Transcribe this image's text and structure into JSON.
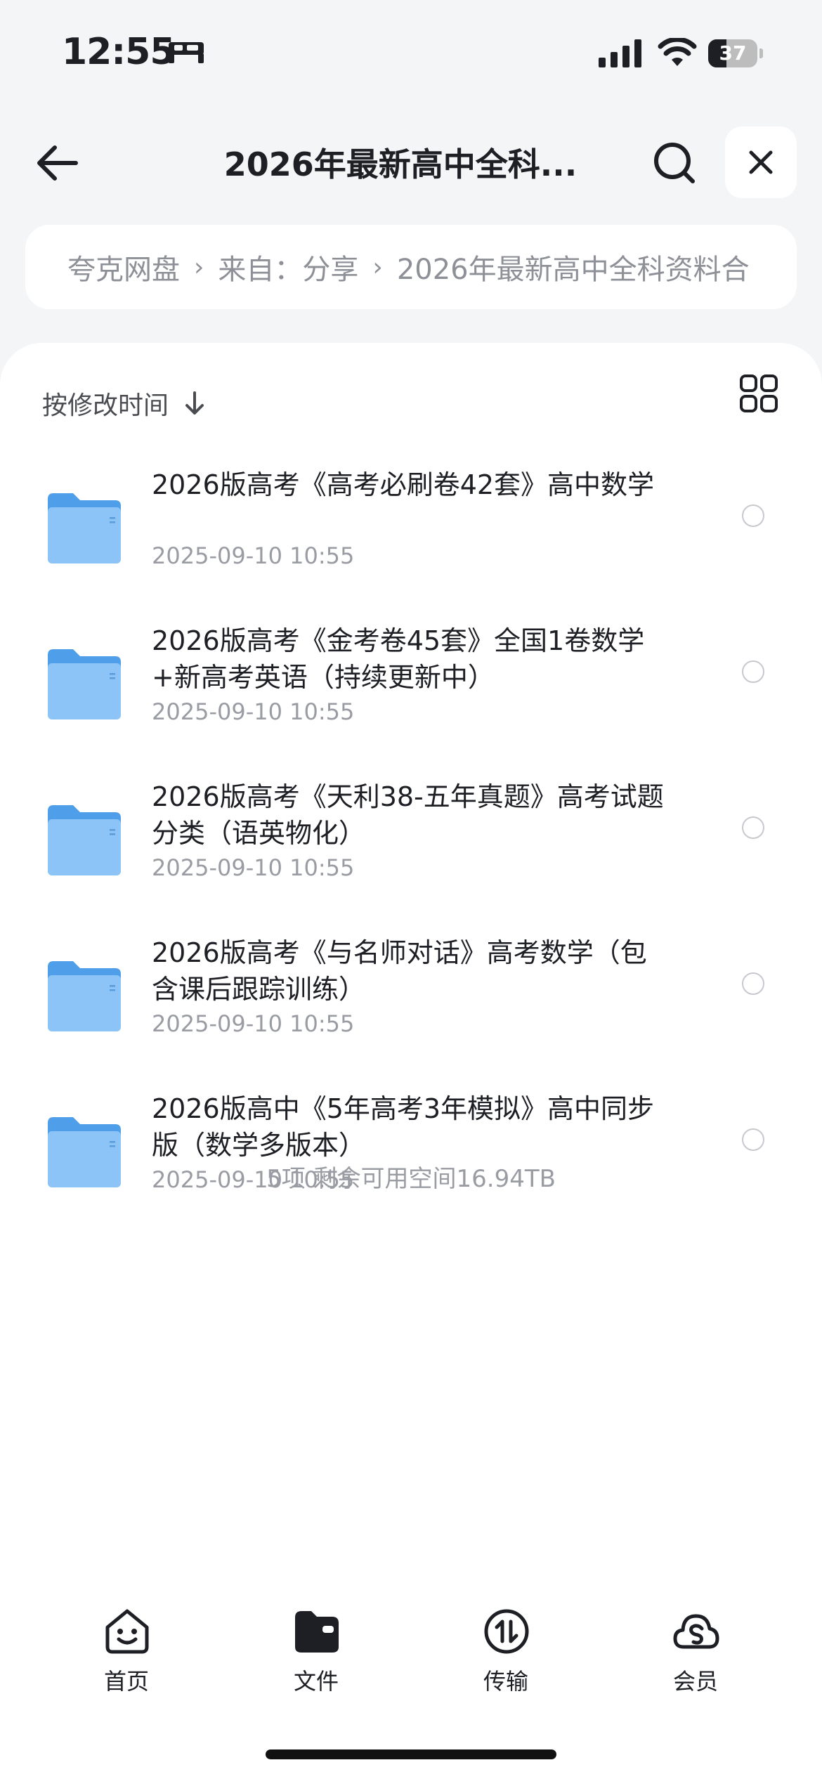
{
  "status_bar": {
    "time": "12:55",
    "battery": "37",
    "battery_level": 0.37
  },
  "header": {
    "title": "2026年最新高中全科..."
  },
  "breadcrumb": {
    "items": [
      {
        "label": "夸克网盘"
      },
      {
        "label": "来自：分享"
      },
      {
        "label": "2026年最新高中全科资料合"
      }
    ],
    "separator": "›"
  },
  "toolbar": {
    "sort_label": "按修改时间",
    "sort_arrow": "↓"
  },
  "files": [
    {
      "name": "2026版高考《高考必刷卷42套》高中数学",
      "date": "2025-09-10 10:55"
    },
    {
      "name": "2026版高考《金考卷45套》全国1卷数学+新高考英语（持续更新中）",
      "date": "2025-09-10 10:55"
    },
    {
      "name": "2026版高考《天利38-五年真题》高考试题分类（语英物化）",
      "date": "2025-09-10 10:55"
    },
    {
      "name": "2026版高考《与名师对话》高考数学（包含课后跟踪训练）",
      "date": "2025-09-10 10:55"
    },
    {
      "name": "2026版高中《5年高考3年模拟》高中同步版（数学多版本）",
      "date": "2025-09-10 10:55"
    }
  ],
  "summary": "5项 剩余可用空间16.94TB",
  "tabs": [
    {
      "label": "首页",
      "icon": "home-face-icon"
    },
    {
      "label": "文件",
      "icon": "folder-icon"
    },
    {
      "label": "传输",
      "icon": "transfer-icon"
    },
    {
      "label": "会员",
      "icon": "cloud-vip-icon"
    }
  ],
  "colors": {
    "folder": "#5aa9f0",
    "accent": "#1d1f24",
    "muted": "#9a9ca3"
  }
}
